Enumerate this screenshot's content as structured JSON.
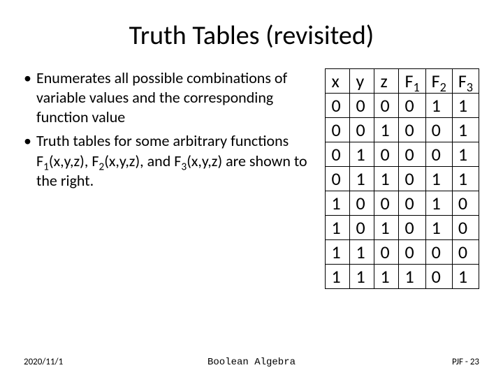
{
  "title": "Truth Tables (revisited)",
  "bullets": [
    {
      "text": "Enumerates all possible combinations of variable values and the corresponding function value"
    },
    {
      "html": "Truth tables for some arbitrary functions<br>F<span class=\"sub\">1</span>(x,y,z), F<span class=\"sub\">2</span>(x,y,z), and F<span class=\"sub\">3</span>(x,y,z) are shown to the right."
    }
  ],
  "table": {
    "headers": [
      "x",
      "y",
      "z",
      "F1",
      "F2",
      "F3"
    ],
    "header_html": [
      "x",
      "y",
      "z",
      "F<span class=\"sub\">1</span>",
      "F<span class=\"sub\">2</span>",
      "F<span class=\"sub\">3</span>"
    ],
    "rows": [
      [
        "0",
        "0",
        "0",
        "0",
        "1",
        "1"
      ],
      [
        "0",
        "0",
        "1",
        "0",
        "0",
        "1"
      ],
      [
        "0",
        "1",
        "0",
        "0",
        "0",
        "1"
      ],
      [
        "0",
        "1",
        "1",
        "0",
        "1",
        "1"
      ],
      [
        "1",
        "0",
        "0",
        "0",
        "1",
        "0"
      ],
      [
        "1",
        "0",
        "1",
        "0",
        "1",
        "0"
      ],
      [
        "1",
        "1",
        "0",
        "0",
        "0",
        "0"
      ],
      [
        "1",
        "1",
        "1",
        "1",
        "0",
        "1"
      ]
    ]
  },
  "footer": {
    "date": "2020/11/1",
    "center": "Boolean Algebra",
    "right": "PJF - 23"
  },
  "chart_data": {
    "type": "table",
    "title": "Truth Tables (revisited)",
    "columns": [
      "x",
      "y",
      "z",
      "F1",
      "F2",
      "F3"
    ],
    "rows": [
      [
        0,
        0,
        0,
        0,
        1,
        1
      ],
      [
        0,
        0,
        1,
        0,
        0,
        1
      ],
      [
        0,
        1,
        0,
        0,
        0,
        1
      ],
      [
        0,
        1,
        1,
        0,
        1,
        1
      ],
      [
        1,
        0,
        0,
        0,
        1,
        0
      ],
      [
        1,
        0,
        1,
        0,
        1,
        0
      ],
      [
        1,
        1,
        0,
        0,
        0,
        0
      ],
      [
        1,
        1,
        1,
        1,
        0,
        1
      ]
    ]
  }
}
